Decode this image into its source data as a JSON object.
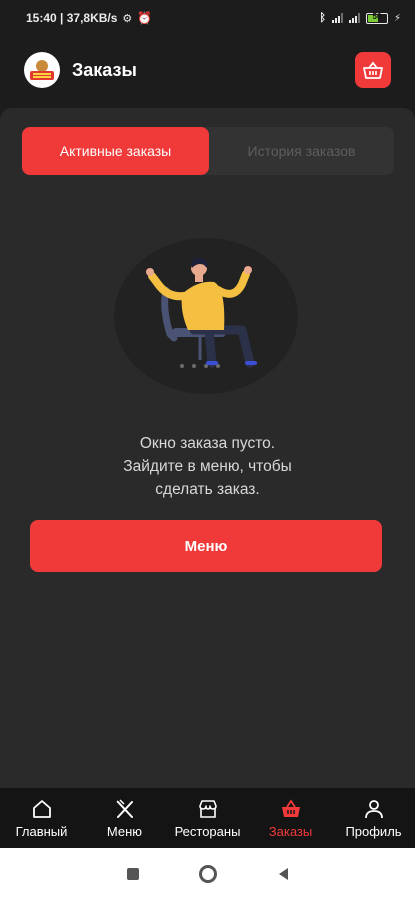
{
  "status_bar": {
    "time_info": "15:40 | 37,8KB/s",
    "battery": "56"
  },
  "header": {
    "title": "Заказы",
    "logo_icon": "brand-logo",
    "basket_icon": "basket-icon"
  },
  "tabs": [
    {
      "label": "Активные заказы",
      "active": true
    },
    {
      "label": "История заказов",
      "active": false
    }
  ],
  "empty_state": {
    "lines": [
      "Окно заказа пусто.",
      "Зайдите в меню, чтобы",
      "сделать заказ."
    ],
    "button_label": "Меню"
  },
  "bottom_nav": [
    {
      "label": "Главный",
      "icon": "home-icon",
      "active": false
    },
    {
      "label": "Меню",
      "icon": "cutlery-icon",
      "active": false
    },
    {
      "label": "Рестораны",
      "icon": "store-icon",
      "active": false
    },
    {
      "label": "Заказы",
      "icon": "basket-icon",
      "active": true
    },
    {
      "label": "Профиль",
      "icon": "person-icon",
      "active": false
    }
  ],
  "colors": {
    "accent": "#f03a3a",
    "background": "#1c1c1c",
    "panel": "#2a2a2a",
    "inactive_tab_text": "#5e5e5e"
  }
}
